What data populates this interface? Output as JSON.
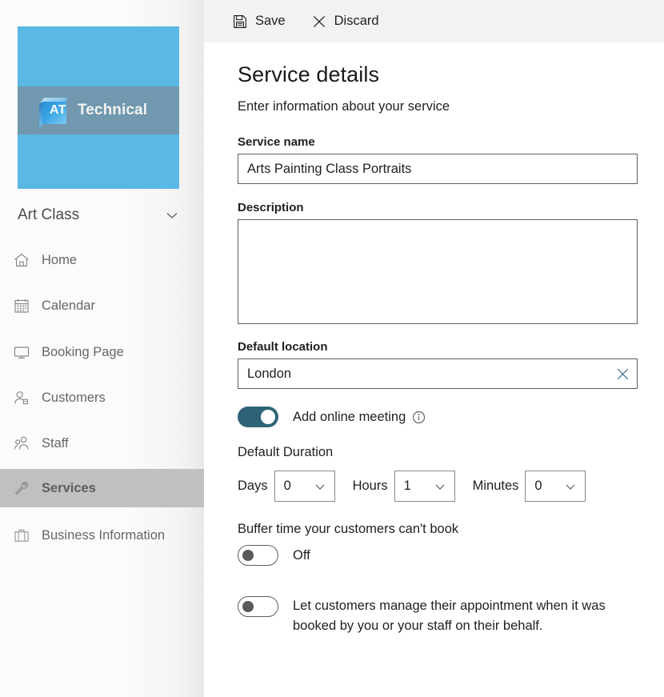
{
  "sidebar": {
    "logo": {
      "cube_text": "AT",
      "brand_text": "Technical"
    },
    "org": {
      "name": "Art Class",
      "chevron_icon": "chevron-down-icon"
    },
    "items": [
      {
        "label": "Home",
        "icon": "home-icon",
        "selected": false
      },
      {
        "label": "Calendar",
        "icon": "calendar-icon",
        "selected": false
      },
      {
        "label": "Booking Page",
        "icon": "monitor-icon",
        "selected": false
      },
      {
        "label": "Customers",
        "icon": "customer-icon",
        "selected": false
      },
      {
        "label": "Staff",
        "icon": "staff-icon",
        "selected": false
      },
      {
        "label": "Services",
        "icon": "wrench-icon",
        "selected": true
      },
      {
        "label": "Business Information",
        "icon": "briefcase-icon",
        "selected": false
      }
    ]
  },
  "toolbar": {
    "save_label": "Save",
    "save_icon": "save-floppy-icon",
    "discard_label": "Discard",
    "discard_icon": "close-x-icon"
  },
  "main": {
    "title": "Service details",
    "subtitle": "Enter information about your service",
    "service_name": {
      "label": "Service name",
      "value": "Arts Painting Class Portraits",
      "placeholder": ""
    },
    "description": {
      "label": "Description",
      "value": "",
      "placeholder": ""
    },
    "default_location": {
      "label": "Default location",
      "value": "London",
      "placeholder": "",
      "clear_icon": "clear-x-icon"
    },
    "online_meeting": {
      "label": "Add online meeting",
      "state": "on",
      "info_icon": "info-circle-icon"
    },
    "duration": {
      "label": "Default Duration",
      "fields": [
        {
          "label": "Days",
          "value": "0"
        },
        {
          "label": "Hours",
          "value": "1"
        },
        {
          "label": "Minutes",
          "value": "0"
        }
      ]
    },
    "buffer_time": {
      "label": "Buffer time your customers can't book",
      "state": "off",
      "state_label": "Off"
    },
    "manage_appointment": {
      "label": "Let customers manage their appointment when it was booked by you or your staff on their behalf.",
      "state": "off"
    }
  },
  "colors": {
    "toggle_on": "#2f6377",
    "sidebar_selected": "#c0c0c0",
    "toolbar_bg": "#f3f2f1",
    "logo_tile": "#5bb8e4"
  }
}
